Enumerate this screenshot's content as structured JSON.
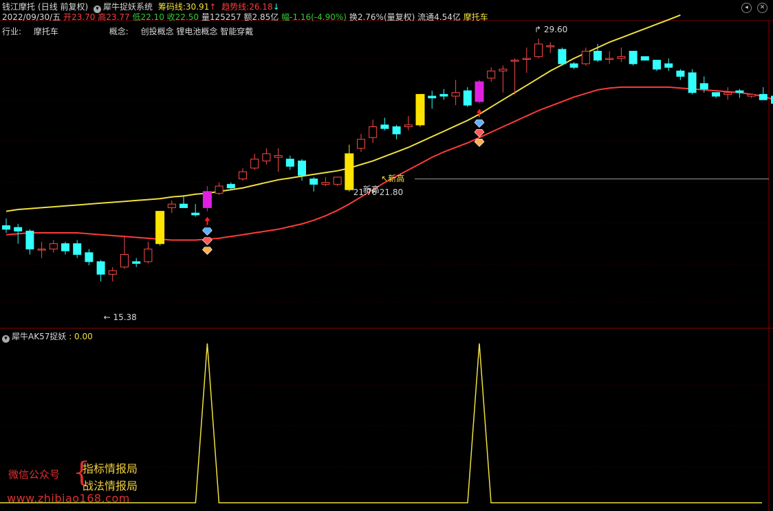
{
  "header": {
    "stock_name": "钱江摩托",
    "period": "(日线 前复权)",
    "indicator": "犀牛捉妖系统",
    "chip_label": "筹码线:",
    "chip_value": "30.91",
    "trend_label": "趋势线:",
    "trend_value": "26.18",
    "up_arrow": "↑",
    "down_arrow": "↓",
    "menu_icon": "circle-chevron-icon",
    "window_buttons": [
      "circle-min-icon",
      "circle-close-icon"
    ],
    "colors": {
      "chip": "#f0e040",
      "trend": "#ff3b3b",
      "up_arrow": "#ff3b3b",
      "down_arrow": "#33ffff"
    }
  },
  "quote": {
    "date": "2022/09/30/五",
    "open_label": "开",
    "open": "23.70",
    "high_label": "高",
    "high": "23.77",
    "low_label": "低",
    "low": "22.10",
    "close_label": "收",
    "close": "22.50",
    "volume_label": "量",
    "volume": "125257",
    "amount_label": "额",
    "amount": "2.85亿",
    "change_label": "幅",
    "change": "-1.16(-4.90%)",
    "turnover_label": "换",
    "turnover": "2.76%(量复权)",
    "float_label": "流通",
    "float": "4.54亿",
    "sector": "摩托车"
  },
  "info": {
    "industry_label": "行业:",
    "industry": "摩托车",
    "concept_label": "概念:",
    "concepts": "创投概念 锂电池概念 智能穿戴"
  },
  "chart_data": {
    "type": "candlestick",
    "price_range": [
      13.8,
      30.6
    ],
    "annotations": {
      "high": "29.60",
      "low": "15.38",
      "mid1": "21.76",
      "mid2": "21.80",
      "new_high": "新高",
      "new_high_2": "新高"
    },
    "candles": [
      {
        "o": 19.2,
        "h": 19.6,
        "l": 18.8,
        "c": 19.0
      },
      {
        "o": 19.1,
        "h": 19.3,
        "l": 18.2,
        "c": 18.9
      },
      {
        "o": 18.9,
        "h": 19.0,
        "l": 17.6,
        "c": 17.9
      },
      {
        "o": 17.9,
        "h": 18.3,
        "l": 17.4,
        "c": 17.9
      },
      {
        "o": 17.9,
        "h": 18.4,
        "l": 17.7,
        "c": 18.2
      },
      {
        "o": 18.2,
        "h": 18.3,
        "l": 17.6,
        "c": 17.8
      },
      {
        "o": 18.2,
        "h": 18.4,
        "l": 17.4,
        "c": 17.6
      },
      {
        "o": 17.7,
        "h": 17.9,
        "l": 17.0,
        "c": 17.2
      },
      {
        "o": 17.2,
        "h": 17.3,
        "l": 16.1,
        "c": 16.5
      },
      {
        "o": 16.5,
        "h": 16.9,
        "l": 16.1,
        "c": 16.7
      },
      {
        "o": 16.9,
        "h": 18.6,
        "l": 16.8,
        "c": 17.6
      },
      {
        "o": 17.2,
        "h": 17.4,
        "l": 16.9,
        "c": 17.1
      },
      {
        "o": 17.2,
        "h": 18.3,
        "l": 17.1,
        "c": 17.9
      },
      {
        "o": 18.2,
        "h": 20.0,
        "l": 18.1,
        "c": 20.0,
        "hl": "yellow"
      },
      {
        "o": 20.2,
        "h": 20.6,
        "l": 19.9,
        "c": 20.4
      },
      {
        "o": 20.4,
        "h": 20.9,
        "l": 20.2,
        "c": 20.2
      },
      {
        "o": 19.9,
        "h": 20.4,
        "l": 19.7,
        "c": 19.8
      },
      {
        "o": 20.2,
        "h": 21.4,
        "l": 20.0,
        "c": 21.1,
        "hl": "magenta"
      },
      {
        "o": 21.0,
        "h": 21.6,
        "l": 20.9,
        "c": 21.4
      },
      {
        "o": 21.5,
        "h": 21.6,
        "l": 21.2,
        "c": 21.3
      },
      {
        "o": 21.8,
        "h": 22.4,
        "l": 21.7,
        "c": 22.2
      },
      {
        "o": 22.4,
        "h": 23.2,
        "l": 22.3,
        "c": 22.9
      },
      {
        "o": 22.8,
        "h": 23.5,
        "l": 22.6,
        "c": 23.2
      },
      {
        "o": 23.0,
        "h": 23.5,
        "l": 22.2,
        "c": 23.1
      },
      {
        "o": 22.9,
        "h": 23.1,
        "l": 22.3,
        "c": 22.5
      },
      {
        "o": 22.8,
        "h": 22.9,
        "l": 21.7,
        "c": 22.0
      },
      {
        "o": 21.8,
        "h": 21.9,
        "l": 21.1,
        "c": 21.5
      },
      {
        "o": 21.5,
        "h": 21.9,
        "l": 21.4,
        "c": 21.6
      },
      {
        "o": 21.5,
        "h": 21.9,
        "l": 21.4,
        "c": 21.9
      },
      {
        "o": 21.2,
        "h": 23.7,
        "l": 21.1,
        "c": 23.2,
        "hl": "yellow"
      },
      {
        "o": 23.5,
        "h": 24.3,
        "l": 23.3,
        "c": 24.0
      },
      {
        "o": 24.1,
        "h": 25.1,
        "l": 23.8,
        "c": 24.7
      },
      {
        "o": 24.8,
        "h": 25.2,
        "l": 24.5,
        "c": 24.6
      },
      {
        "o": 24.7,
        "h": 24.8,
        "l": 24.0,
        "c": 24.3
      },
      {
        "o": 24.7,
        "h": 25.3,
        "l": 24.5,
        "c": 24.8
      },
      {
        "o": 24.8,
        "h": 26.5,
        "l": 24.7,
        "c": 26.5,
        "hl": "yellow"
      },
      {
        "o": 26.4,
        "h": 26.7,
        "l": 25.7,
        "c": 26.3
      },
      {
        "o": 26.5,
        "h": 26.8,
        "l": 26.2,
        "c": 26.4
      },
      {
        "o": 26.4,
        "h": 27.3,
        "l": 25.9,
        "c": 26.6
      },
      {
        "o": 26.7,
        "h": 26.9,
        "l": 25.8,
        "c": 25.9
      },
      {
        "o": 26.1,
        "h": 27.3,
        "l": 26.0,
        "c": 27.2,
        "hl": "magenta"
      },
      {
        "o": 27.4,
        "h": 28.0,
        "l": 27.2,
        "c": 27.8
      },
      {
        "o": 27.8,
        "h": 28.1,
        "l": 26.6,
        "c": 27.9
      },
      {
        "o": 28.4,
        "h": 28.5,
        "l": 26.5,
        "c": 28.4
      },
      {
        "o": 28.5,
        "h": 29.1,
        "l": 27.7,
        "c": 28.5
      },
      {
        "o": 28.6,
        "h": 29.6,
        "l": 28.5,
        "c": 29.3
      },
      {
        "o": 29.2,
        "h": 29.4,
        "l": 28.8,
        "c": 29.2
      },
      {
        "o": 29.0,
        "h": 29.1,
        "l": 28.1,
        "c": 28.2
      },
      {
        "o": 28.2,
        "h": 28.3,
        "l": 27.9,
        "c": 28.0
      },
      {
        "o": 28.2,
        "h": 29.1,
        "l": 28.1,
        "c": 28.9
      },
      {
        "o": 28.9,
        "h": 29.3,
        "l": 28.3,
        "c": 28.4
      },
      {
        "o": 28.5,
        "h": 28.9,
        "l": 28.2,
        "c": 28.5
      },
      {
        "o": 28.5,
        "h": 29.1,
        "l": 28.3,
        "c": 28.6
      },
      {
        "o": 28.9,
        "h": 28.9,
        "l": 28.1,
        "c": 28.2
      },
      {
        "o": 28.6,
        "h": 28.6,
        "l": 28.4,
        "c": 28.4
      },
      {
        "o": 28.4,
        "h": 28.4,
        "l": 27.8,
        "c": 27.9
      },
      {
        "o": 28.2,
        "h": 28.5,
        "l": 27.8,
        "c": 28.0
      },
      {
        "o": 27.8,
        "h": 27.9,
        "l": 27.3,
        "c": 27.5
      },
      {
        "o": 27.7,
        "h": 27.9,
        "l": 26.5,
        "c": 26.6
      },
      {
        "o": 27.1,
        "h": 27.5,
        "l": 26.6,
        "c": 26.8
      },
      {
        "o": 26.6,
        "h": 26.6,
        "l": 26.3,
        "c": 26.4
      },
      {
        "o": 26.5,
        "h": 26.9,
        "l": 26.2,
        "c": 26.6
      },
      {
        "o": 26.7,
        "h": 26.8,
        "l": 26.3,
        "c": 26.6
      },
      {
        "o": 26.4,
        "h": 26.5,
        "l": 26.3,
        "c": 26.5
      },
      {
        "o": 26.5,
        "h": 26.9,
        "l": 26.2,
        "c": 26.2
      },
      {
        "o": 26.4,
        "h": 26.9,
        "l": 25.9,
        "c": 26.0
      },
      {
        "o": 26.7,
        "h": 26.7,
        "l": 25.8,
        "c": 26.0
      },
      {
        "o": 26.1,
        "h": 27.0,
        "l": 25.9,
        "c": 26.8
      },
      {
        "o": 26.8,
        "h": 27.6,
        "l": 26.8,
        "c": 27.2
      },
      {
        "o": 27.1,
        "h": 27.4,
        "l": 26.2,
        "c": 26.2
      },
      {
        "o": 26.4,
        "h": 26.5,
        "l": 25.0,
        "c": 25.3
      },
      {
        "o": 24.8,
        "h": 24.9,
        "l": 23.8,
        "c": 24.0
      }
    ],
    "chip_line": [
      20.0,
      20.1,
      20.15,
      20.2,
      20.25,
      20.3,
      20.35,
      20.4,
      20.45,
      20.5,
      20.55,
      20.6,
      20.65,
      20.7,
      20.8,
      20.85,
      20.95,
      21.0,
      21.1,
      21.2,
      21.3,
      21.45,
      21.6,
      21.75,
      21.85,
      21.95,
      22.05,
      22.15,
      22.25,
      22.4,
      22.6,
      22.8,
      23.05,
      23.3,
      23.55,
      23.85,
      24.15,
      24.45,
      24.75,
      25.05,
      25.4,
      25.8,
      26.2,
      26.6,
      27.0,
      27.4,
      27.8,
      28.15,
      28.5,
      28.8,
      29.1,
      29.4,
      29.65,
      29.9,
      30.15,
      30.4,
      30.65,
      30.91
    ],
    "trend_line": [
      18.7,
      18.75,
      18.8,
      18.8,
      18.8,
      18.8,
      18.8,
      18.75,
      18.7,
      18.65,
      18.6,
      18.55,
      18.5,
      18.45,
      18.4,
      18.4,
      18.4,
      18.45,
      18.5,
      18.6,
      18.7,
      18.8,
      18.9,
      19.0,
      19.15,
      19.3,
      19.5,
      19.75,
      20.05,
      20.4,
      20.8,
      21.2,
      21.6,
      21.95,
      22.3,
      22.65,
      23.0,
      23.3,
      23.55,
      23.8,
      24.1,
      24.4,
      24.7,
      25.0,
      25.3,
      25.6,
      25.85,
      26.1,
      26.35,
      26.55,
      26.75,
      26.85,
      26.9,
      26.9,
      26.9,
      26.9,
      26.9,
      26.85,
      26.8,
      26.75,
      26.7,
      26.65,
      26.6,
      26.5,
      26.4,
      26.18
    ],
    "reference_price": 21.8,
    "signal_indices": [
      17,
      40
    ]
  },
  "indicator_panel": {
    "title": "犀牛AK57捉妖",
    "value_label": ": 0.00",
    "line_color": "#f0e040",
    "signal_indices": [
      17,
      40
    ]
  },
  "watermark": {
    "wechat": "微信公众号",
    "brace": "{",
    "line1": "指标情报局",
    "line2": "战法情报局",
    "url": "www.zhibiao168.com"
  }
}
